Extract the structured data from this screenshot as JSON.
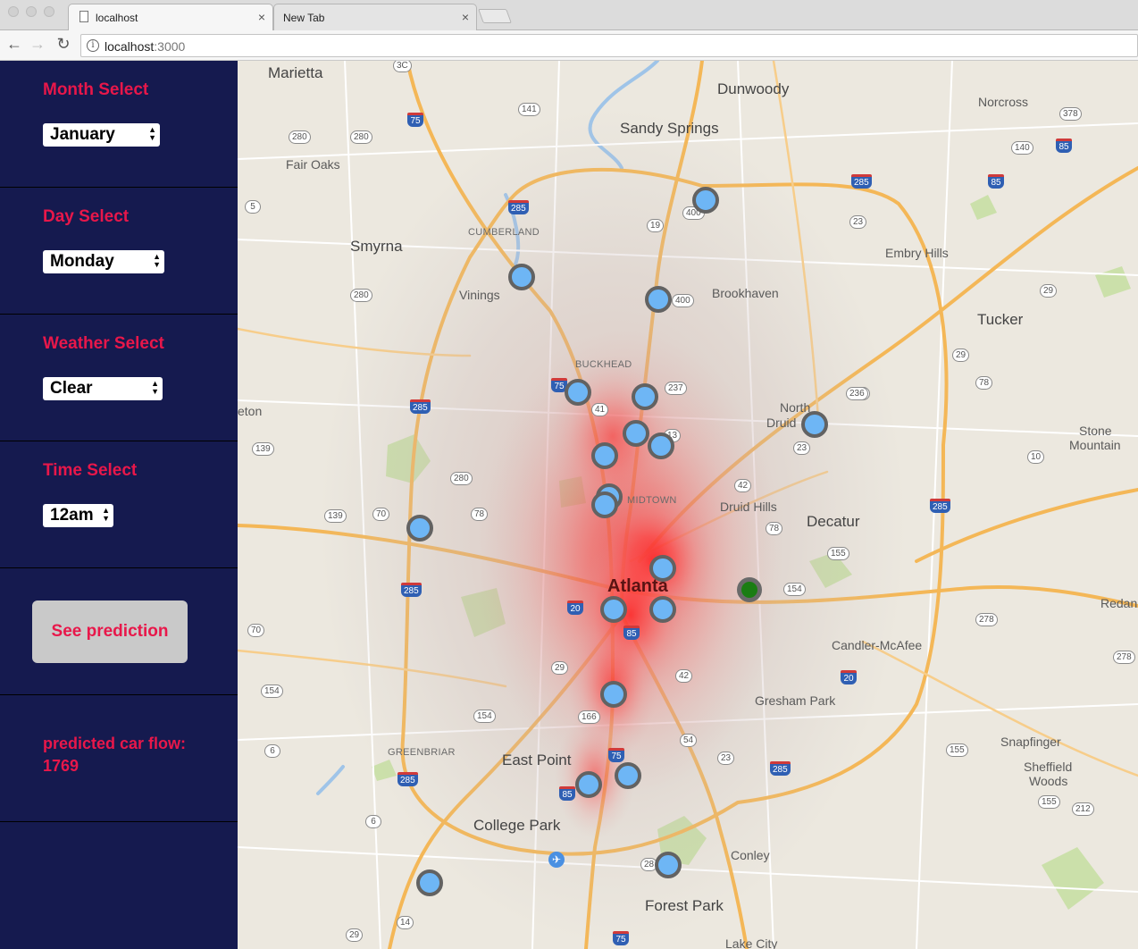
{
  "browser": {
    "tabs": [
      {
        "title": "localhost",
        "active": true
      },
      {
        "title": "New Tab",
        "active": false
      }
    ],
    "close_glyph": "×",
    "nav": {
      "back": "←",
      "forward": "→",
      "reload": "↻"
    },
    "url_host": "localhost",
    "url_port": ":3000"
  },
  "sidebar": {
    "month": {
      "label": "Month Select",
      "value": "January"
    },
    "day": {
      "label": "Day Select",
      "value": "Monday"
    },
    "weather": {
      "label": "Weather Select",
      "value": "Clear"
    },
    "time": {
      "label": "Time Select",
      "value": "12am"
    },
    "predict_button": "See prediction",
    "result_label": "predicted car flow:",
    "result_value": "1769"
  },
  "map": {
    "places": {
      "marietta": "Marietta",
      "dunwoody": "Dunwoody",
      "norcross": "Norcross",
      "sandy_springs": "Sandy Springs",
      "fair_oaks": "Fair Oaks",
      "smyrna": "Smyrna",
      "cumberland": "CUMBERLAND",
      "vinings": "Vinings",
      "embry_hills": "Embry Hills",
      "brookhaven": "Brookhaven",
      "tucker": "Tucker",
      "buckhead": "BUCKHEAD",
      "north_druid": "North",
      "north_druid2": "Druid",
      "eton": "eton",
      "stone_mountain": "Stone",
      "stone_mountain2": "Mountain",
      "midtown": "MIDTOWN",
      "druid_hills": "Druid Hills",
      "decatur": "Decatur",
      "atlanta": "Atlanta",
      "redan": "Redan",
      "candler": "Candler-McAfee",
      "gresham": "Gresham Park",
      "snapfinger": "Snapfinger",
      "sheffield": "Sheffield",
      "sheffield2": "Woods",
      "greenbriar": "GREENBRIAR",
      "east_point": "East Point",
      "college_park": "College Park",
      "conley": "Conley",
      "forest_park": "Forest Park",
      "lake_city": "Lake City"
    },
    "highway_shields": [
      "3C",
      "75",
      "280",
      "280",
      "141",
      "378",
      "140",
      "85",
      "285",
      "85",
      "5",
      "285",
      "19",
      "400",
      "23",
      "280",
      "400",
      "29",
      "236",
      "285",
      "75",
      "41",
      "237",
      "236",
      "29",
      "78",
      "139",
      "13",
      "23",
      "10",
      "280",
      "42",
      "139",
      "70",
      "78",
      "78",
      "285",
      "155",
      "285",
      "154",
      "20",
      "85",
      "70",
      "278",
      "278",
      "29",
      "42",
      "20",
      "154",
      "154",
      "166",
      "54",
      "6",
      "75",
      "23",
      "285",
      "155",
      "285",
      "85",
      "155",
      "212",
      "6",
      "28",
      "14",
      "29",
      "75"
    ],
    "active_marker_color": "#1a7d13",
    "marker_color": "#6eb6f5",
    "heat_color": "#ff2a2a"
  }
}
